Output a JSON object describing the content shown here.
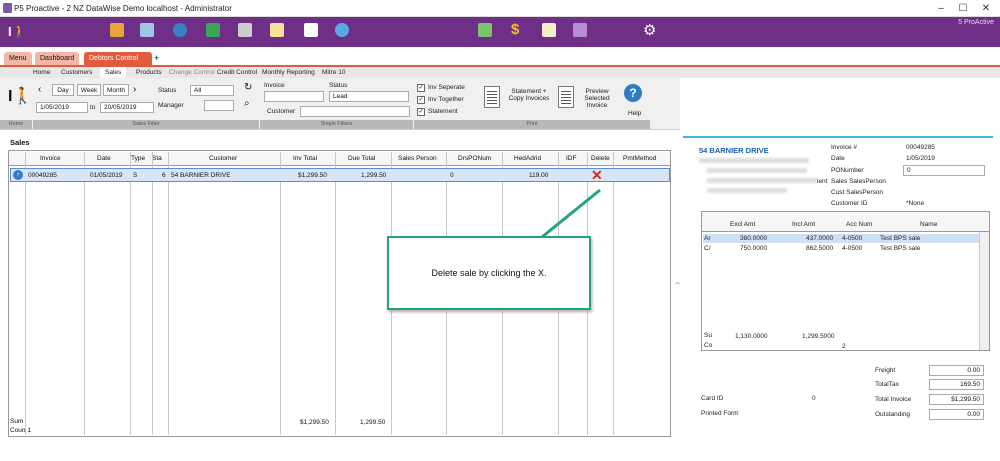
{
  "window": {
    "title": "P5 Proactive - 2 NZ DataWise Demo localhost - Administrator",
    "brand": "5 ProActive"
  },
  "tabs": [
    "Menu",
    "Dashboard",
    "Debtors Control",
    "+"
  ],
  "subnav": [
    "Home",
    "Customers",
    "Sales",
    "Products",
    "Change Control",
    "Credit Control",
    "Monthly Reporting",
    "Mitre 10"
  ],
  "ribbon": {
    "day": "Day",
    "week": "Week",
    "month": "Month",
    "date_from": "1/05/2019",
    "to": "to",
    "date_to": "20/05/2019",
    "status_label": "Status",
    "status_value": "All",
    "manager_label": "Manager",
    "manager_value": "",
    "invoice_label": "Invoice",
    "status2_label": "Status",
    "status2_value": "Lead",
    "customer_label": "Customer",
    "chk_sep": "Inv Seperate",
    "chk_tog": "Inv Together",
    "chk_stmt": "Statement",
    "stmt_copy": "Statement + Copy Invoices",
    "preview": "Preview Selected Invoice",
    "help": "Help",
    "grp_home": "Home",
    "grp_sales": "Sales Filter",
    "grp_single": "Single Filters",
    "grp_print": "Print"
  },
  "sales": {
    "title": "Sales",
    "headers": [
      "Invoice",
      "Date",
      "Type",
      "Sta",
      "Customer",
      "Inv Total",
      "Due Total",
      "Sales Person",
      "DrsPONum",
      "HedAdrid",
      "IDF",
      "Delete",
      "PmtMethod"
    ],
    "row": {
      "invoice": "00049285",
      "date": "01/05/2019",
      "type": "S",
      "sta": "6",
      "customer": "54 BARNIER DRIVE",
      "inv_total": "$1,299.50",
      "due_total": "1,299.50",
      "drspo": "0",
      "hedadrid": "119.00"
    },
    "sum_label": "Sum",
    "count_label": "Coun 1",
    "sum_inv": "$1,299.50",
    "sum_due": "1,299.50"
  },
  "callout": "Delete sale by clicking the X.",
  "detail": {
    "title": "54 BARNIER DRIVE",
    "invoice_label": "Invoice #",
    "invoice": "00049285",
    "date_label": "Date",
    "date": "1/05/2019",
    "po_label": "PONumber",
    "po": "0",
    "sp_label": "Sales SalesPerson",
    "csp_label": "Cust SalesPerson",
    "cid_label": "Customer ID",
    "cid": "*None",
    "ient": "ient",
    "lines_headers": [
      "Excl Amt",
      "Incl Amt",
      "Acc Num",
      "Name"
    ],
    "lines": [
      {
        "tag": "Ar",
        "excl": "380.0000",
        "incl": "437.0000",
        "acc": "4-0500",
        "name": "Test BPS sale"
      },
      {
        "tag": "C/",
        "excl": "750.0000",
        "incl": "862.5000",
        "acc": "4-0500",
        "name": "Test BPS sale"
      }
    ],
    "sum_tag": "Su",
    "co_tag": "Co",
    "sum_excl": "1,130.0000",
    "sum_incl": "1,299.5000",
    "count": "2",
    "freight_label": "Freight",
    "freight": "0.00",
    "tax_label": "TotalTax",
    "tax": "169.50",
    "card_label": "Card ID",
    "card": "0",
    "total_label": "Total Invoice",
    "total": "$1,299.50",
    "printed_label": "Printed Form",
    "out_label": "Outstanding",
    "out": "0.00"
  }
}
